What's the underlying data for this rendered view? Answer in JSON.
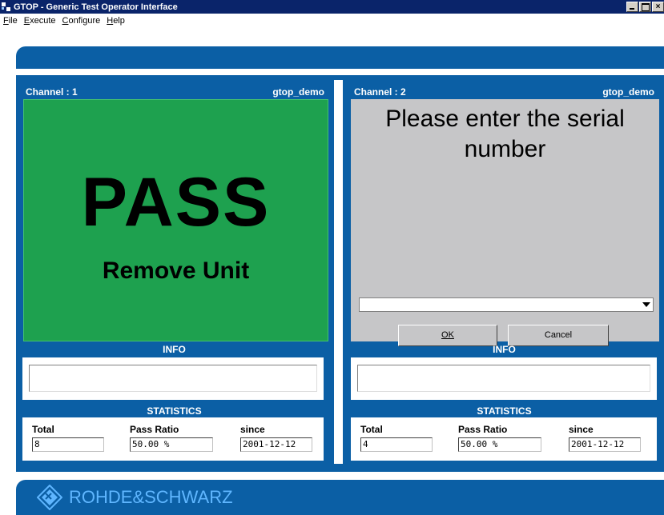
{
  "window": {
    "title": "GTOP - Generic Test Operator Interface"
  },
  "menu": [
    {
      "label": "File",
      "accel": "F",
      "rest": "ile"
    },
    {
      "label": "Execute",
      "accel": "E",
      "rest": "xecute"
    },
    {
      "label": "Configure",
      "accel": "C",
      "rest": "onfigure"
    },
    {
      "label": "Help",
      "accel": "H",
      "rest": "elp"
    }
  ],
  "channels": [
    {
      "label": "Channel : 1",
      "sequence": "gtop_demo",
      "status": "PASS",
      "message": "Remove Unit",
      "status_color": "#1ea14f",
      "info_label": "INFO",
      "info_text": "",
      "stats_label": "STATISTICS",
      "total_label": "Total",
      "total": "8",
      "ratio_label": "Pass Ratio",
      "ratio": "50.00 %",
      "since_label": "since",
      "since": "2001-12-12"
    },
    {
      "label": "Channel : 2",
      "sequence": "gtop_demo",
      "prompt": "Please enter the serial number",
      "serial_value": "",
      "ok_label": "OK",
      "cancel_label": "Cancel",
      "info_label": "INFO",
      "info_text": "",
      "stats_label": "STATISTICS",
      "total_label": "Total",
      "total": "4",
      "ratio_label": "Pass Ratio",
      "ratio": "50.00 %",
      "since_label": "since",
      "since": "2001-12-12"
    }
  ],
  "footer": {
    "brand": "ROHDE&SCHWARZ"
  },
  "colors": {
    "panel_blue": "#0b5fa5",
    "pass_green": "#1ea14f",
    "prompt_gray": "#c6c6c8"
  }
}
